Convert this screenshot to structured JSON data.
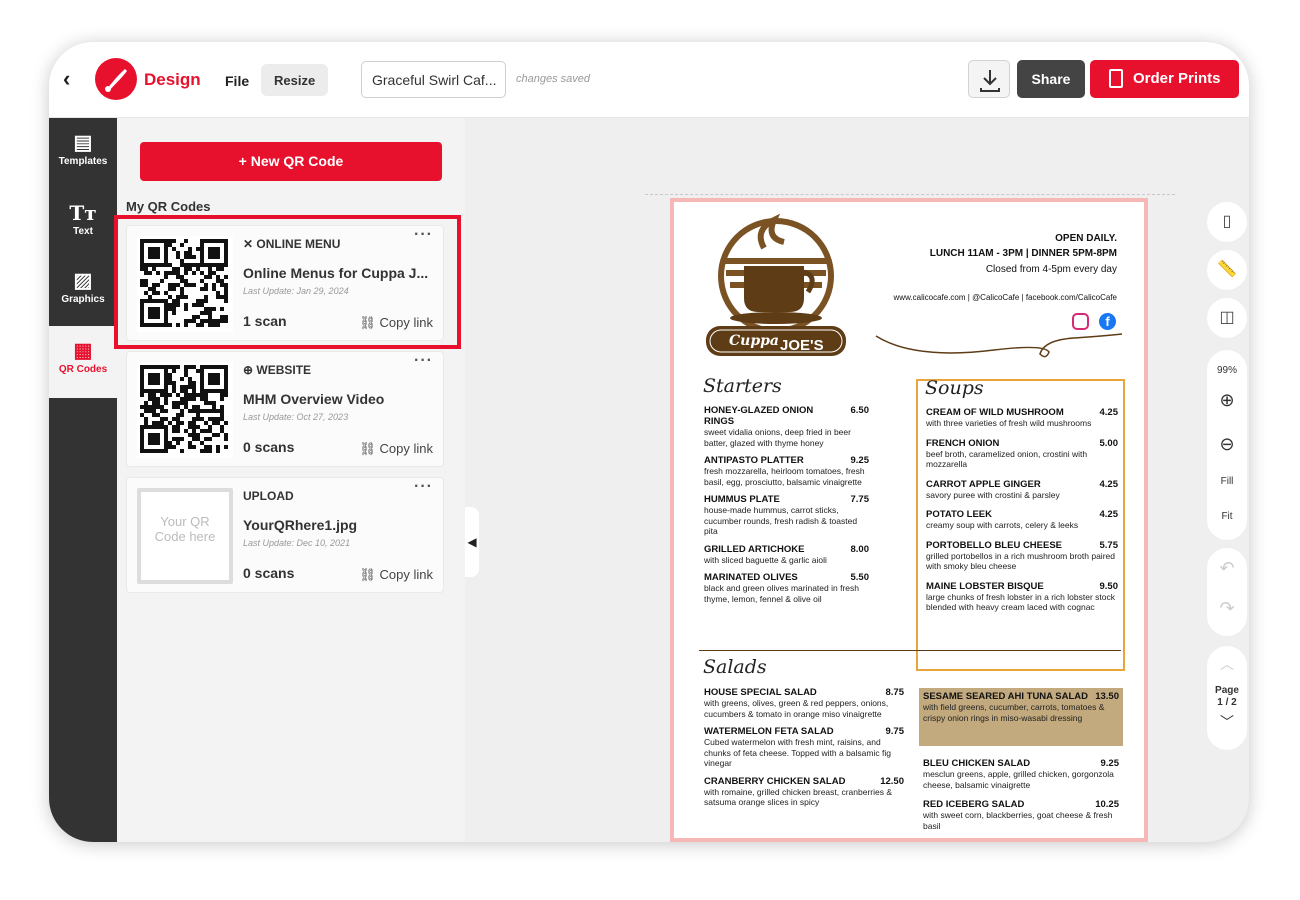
{
  "topbar": {
    "brand": "Design",
    "file_label": "File",
    "resize_label": "Resize",
    "doc_name": "Graceful Swirl Caf...",
    "save_status": "changes saved",
    "share_label": "Share",
    "order_label": "Order Prints"
  },
  "rail": {
    "items": [
      {
        "label": "Templates",
        "icon": "templates-icon"
      },
      {
        "label": "Text",
        "icon": "text-icon"
      },
      {
        "label": "Graphics",
        "icon": "graphics-icon"
      },
      {
        "label": "QR Codes",
        "icon": "qr-codes-icon"
      }
    ]
  },
  "panel": {
    "new_button": "+ New QR Code",
    "section_title": "My QR Codes",
    "cards": [
      {
        "type": "ONLINE MENU",
        "title": "Online Menus for Cuppa J...",
        "updated": "Last Update: Jan 29, 2024",
        "scans": "1 scan",
        "copy": "Copy link"
      },
      {
        "type": "WEBSITE",
        "title": "MHM Overview Video",
        "updated": "Last Update: Oct 27, 2023",
        "scans": "0 scans",
        "copy": "Copy link"
      },
      {
        "type": "UPLOAD",
        "title": "YourQRhere1.jpg",
        "updated": "Last Update: Dec 10, 2021",
        "scans": "0 scans",
        "copy": "Copy link",
        "placeholder": "Your QR Code here"
      }
    ]
  },
  "menu": {
    "logo_line1": "Cuppa",
    "logo_line2": "JOE'S",
    "open": "OPEN DAILY.",
    "hours": "LUNCH 11AM - 3PM | DINNER 5PM-8PM",
    "closed": "Closed from 4-5pm every day",
    "social": "www.calicocafe.com | @CalicoCafe | facebook.com/CalicoCafe",
    "starters_title": "Starters",
    "soups_title": "Soups",
    "salads_title": "Salads",
    "starters": [
      {
        "name": "HONEY-GLAZED ONION RINGS",
        "price": "6.50",
        "desc": "sweet vidalia onions, deep fried in beer batter, glazed with thyme honey"
      },
      {
        "name": "ANTIPASTO PLATTER",
        "price": "9.25",
        "desc": "fresh mozzarella, heirloom tomatoes, fresh basil, egg, prosciutto, balsamic vinaigrette"
      },
      {
        "name": "HUMMUS PLATE",
        "price": "7.75",
        "desc": "house-made hummus, carrot sticks, cucumber rounds, fresh radish & toasted pita"
      },
      {
        "name": "GRILLED ARTICHOKE",
        "price": "8.00",
        "desc": "with sliced baguette & garlic aioli"
      },
      {
        "name": "MARINATED OLIVES",
        "price": "5.50",
        "desc": "black and green olives marinated in fresh thyme, lemon, fennel & olive oil"
      }
    ],
    "soups": [
      {
        "name": "CREAM OF WILD MUSHROOM",
        "price": "4.25",
        "desc": "with three varieties of fresh wild mushrooms"
      },
      {
        "name": "FRENCH ONION",
        "price": "5.00",
        "desc": "beef broth, caramelized onion, crostini with mozzarella"
      },
      {
        "name": "CARROT APPLE GINGER",
        "price": "4.25",
        "desc": "savory puree with crostini & parsley"
      },
      {
        "name": "POTATO LEEK",
        "price": "4.25",
        "desc": "creamy soup with carrots, celery & leeks"
      },
      {
        "name": "PORTOBELLO BLEU CHEESE",
        "price": "5.75",
        "desc": "grilled portobellos in a rich mushroom broth paired with smoky bleu cheese"
      },
      {
        "name": "MAINE LOBSTER BISQUE",
        "price": "9.50",
        "desc": "large chunks of fresh lobster in a rich lobster stock blended with heavy cream laced with cognac"
      }
    ],
    "salads_left": [
      {
        "name": "HOUSE SPECIAL SALAD",
        "price": "8.75",
        "desc": "with greens, olives, green & red peppers, onions, cucumbers & tomato in orange miso vinaigrette"
      },
      {
        "name": "WATERMELON FETA SALAD",
        "price": "9.75",
        "desc": "Cubed watermelon with fresh mint, raisins, and chunks of feta cheese. Topped with a balsamic fig vinegar"
      },
      {
        "name": "CRANBERRY CHICKEN SALAD",
        "price": "12.50",
        "desc": "with romaine, grilled chicken breast, cranberries & satsuma orange slices in spicy"
      }
    ],
    "ahi": {
      "name": "SESAME SEARED AHI TUNA SALAD",
      "price": "13.50",
      "desc": "with field greens, cucumber, carrots, tomatoes & crispy onion rings in miso-wasabi dressing"
    },
    "salads_right": [
      {
        "name": "BLEU CHICKEN SALAD",
        "price": "9.25",
        "desc": "mesclun greens, apple, grilled chicken, gorgonzola cheese, balsamic vinaigrette"
      },
      {
        "name": "RED ICEBERG SALAD",
        "price": "10.25",
        "desc": "with sweet corn, blackberries, goat cheese & fresh basil"
      }
    ]
  },
  "tools": {
    "zoom": "99%",
    "fill": "Fill",
    "fit": "Fit",
    "page_label": "Page",
    "page_num": "1 / 2"
  }
}
